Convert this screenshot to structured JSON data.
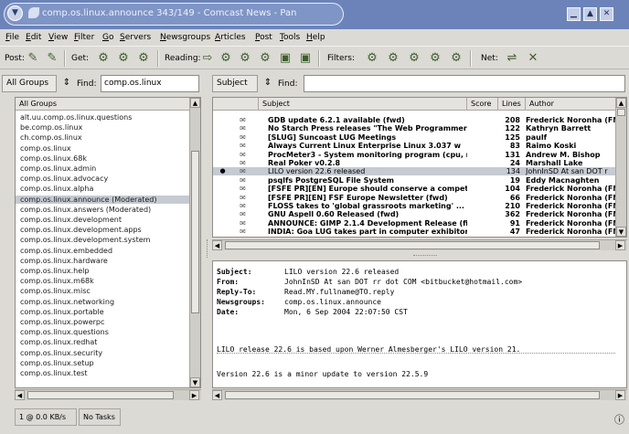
{
  "window": {
    "title": "comp.os.linux.announce 343/149 - Comcast News - Pan",
    "menu_icon": "chevron-down-icon",
    "buttons": [
      "minimize-icon",
      "maximize-icon",
      "close-icon"
    ]
  },
  "menu": [
    "File",
    "Edit",
    "View",
    "Filter",
    "Go",
    "Servers",
    "Newsgroups",
    "Articles",
    "Post",
    "Tools",
    "Help"
  ],
  "toolbar": {
    "post_label": "Post:",
    "get_label": "Get:",
    "reading_label": "Reading:",
    "filters_label": "Filters:",
    "net_label": "Net:"
  },
  "groups_filter": {
    "combo_value": "All Groups",
    "find_label": "Find:",
    "find_value": "comp.os.linux"
  },
  "subject_filter": {
    "combo_value": "Subject",
    "find_label": "Find:",
    "find_value": ""
  },
  "group_list": {
    "header": "All Groups",
    "items": [
      "alt.uu.comp.os.linux.questions",
      "be.comp.os.linux",
      "ch.comp.os.linux",
      "comp.os.linux",
      "comp.os.linux.68k",
      "comp.os.linux.admin",
      "comp.os.linux.advocacy",
      "comp.os.linux.alpha",
      "comp.os.linux.announce (Moderated)",
      "comp.os.linux.answers (Moderated)",
      "comp.os.linux.development",
      "comp.os.linux.development.apps",
      "comp.os.linux.development.system",
      "comp.os.linux.embedded",
      "comp.os.linux.hardware",
      "comp.os.linux.help",
      "comp.os.linux.m68k",
      "comp.os.linux.misc",
      "comp.os.linux.networking",
      "comp.os.linux.portable",
      "comp.os.linux.powerpc",
      "comp.os.linux.questions",
      "comp.os.linux.redhat",
      "comp.os.linux.security",
      "comp.os.linux.setup",
      "comp.os.linux.test"
    ],
    "selected_index": 8
  },
  "header_list": {
    "columns": [
      "Subject",
      "Score",
      "Lines",
      "Author"
    ],
    "rows": [
      {
        "subject": "GDB update 6.2.1 available (fwd)",
        "lines": "208",
        "author": "Frederick Noronha (FN",
        "read": false
      },
      {
        "subject": "No Starch Press releases \"The Web Programmer'",
        "lines": "122",
        "author": "Kathryn Barrett",
        "read": false
      },
      {
        "subject": "[SLUG] Suncoast LUG Meetings",
        "lines": "125",
        "author": "paulf",
        "read": false
      },
      {
        "subject": "Always Current Linux Enterprise Linux 3.037 w",
        "lines": "83",
        "author": "Raimo Koski",
        "read": false
      },
      {
        "subject": "ProcMeter3 - System monitoring program (cpu, n",
        "lines": "131",
        "author": "Andrew M. Bishop",
        "read": false
      },
      {
        "subject": "Real Poker v0.2.8",
        "lines": "24",
        "author": "Marshall Lake",
        "read": false
      },
      {
        "subject": "LILO version 22.6 released",
        "lines": "134",
        "author": "JohnInSD At san DOT r",
        "read": true,
        "selected": true
      },
      {
        "subject": "psqlfs PostgreSQL File System",
        "lines": "19",
        "author": "Eddy Macnaghten",
        "read": false
      },
      {
        "subject": "[FSFE PR][EN] Europe should conserve a compet",
        "lines": "104",
        "author": "Frederick Noronha (FN",
        "read": false
      },
      {
        "subject": "[FSFE PR][EN] FSF Europe Newsletter (fwd)",
        "lines": "66",
        "author": "Frederick Noronha (FN",
        "read": false
      },
      {
        "subject": "FLOSS takes to 'global grassroots marketing' ...",
        "lines": "210",
        "author": "Frederick Noronha (FN",
        "read": false
      },
      {
        "subject": "GNU Aspell 0.60 Released (fwd)",
        "lines": "362",
        "author": "Frederick Noronha (FN",
        "read": false
      },
      {
        "subject": "ANNOUNCE: GIMP 2.1.4 Development Release (fi",
        "lines": "91",
        "author": "Frederick Noronha (FN",
        "read": false
      },
      {
        "subject": "INDIA: Goa LUG takes part in computer exhibitor",
        "lines": "47",
        "author": "Frederick Noronha (FN",
        "read": false
      }
    ]
  },
  "article": {
    "headers": [
      {
        "key": "Subject:",
        "value": "LILO version 22.6 released"
      },
      {
        "key": "From:",
        "value": "JohnInSD At san DOT rr dot COM <bitbucket@hotmail.com>"
      },
      {
        "key": "Reply-To:",
        "value": "Read.MY.fullname@TO.reply"
      },
      {
        "key": "Newsgroups:",
        "value": "comp.os.linux.announce"
      },
      {
        "key": "Date:",
        "value": "Mon, 6 Sep 2004 22:07:50 CST"
      }
    ],
    "body": [
      "LILO release 22.6 is based upon Werner Almesberger's LILO version 21.",
      "Version 22.6 is a minor update to version 22.5.9"
    ]
  },
  "status": {
    "connections": "1 @ 0.0 KB/s",
    "tasks": "No Tasks"
  },
  "colors": {
    "titlebar": "#6b83b9",
    "selection": "#c6cad2",
    "window_bg": "#dcdad5"
  }
}
